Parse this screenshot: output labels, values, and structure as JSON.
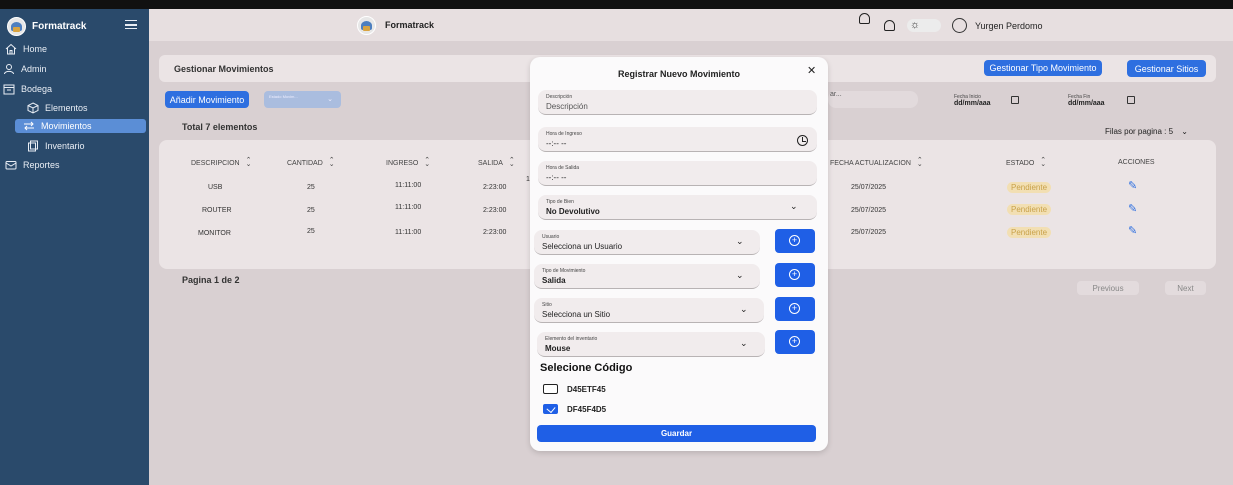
{
  "app": {
    "name": "Formatrack"
  },
  "sidebar": {
    "items": [
      {
        "label": "Home"
      },
      {
        "label": "Admin"
      },
      {
        "label": "Bodega"
      },
      {
        "label": "Elementos"
      },
      {
        "label": "Movimientos"
      },
      {
        "label": "Inventario"
      },
      {
        "label": "Reportes"
      }
    ]
  },
  "header": {
    "title": "Formatrack",
    "user": "Yurgen Perdomo"
  },
  "main": {
    "title": "Gestionar Movimientos",
    "btn_tipo": "Gestionar Tipo Movimiento",
    "btn_sitios": "Gestionar Sitios",
    "btn_add": "Añadir Movimiento",
    "filter_label": "Estado\nMovim...",
    "total": "Total 7 elementos",
    "search_frag": "ar...",
    "fecha_inicio_label": "Fecha Inicio",
    "fecha_fin_label": "Fecha Fin",
    "date_ph": "dd/mm/aaa",
    "filas": "Filas por pagina : 5",
    "pagina": "Pagina 1 de 2",
    "previous": "Previous",
    "next": "Next"
  },
  "table": {
    "headers": {
      "descripcion": "DESCRIPCION",
      "cantidad": "CANTIDAD",
      "ingreso": "INGRESO",
      "salida": "SALIDA",
      "fecha_act": "FECHA ACTUALIZACION",
      "estado": "ESTADO",
      "acciones": "ACCIONES"
    },
    "rows": [
      {
        "descripcion": "USB",
        "cantidad": "25",
        "ingreso": "11:11:00",
        "salida": "2:23:00",
        "fecha": "25/07/2025",
        "estado": "Pendiente"
      },
      {
        "descripcion": "ROUTER",
        "cantidad": "25",
        "ingreso": "11:11:00",
        "salida": "2:23:00",
        "fecha": "25/07/2025",
        "estado": "Pendiente"
      },
      {
        "descripcion": "MONITOR",
        "cantidad": "25",
        "ingreso": "11:11:00",
        "salida": "2:23:00",
        "fecha": "25/07/2025",
        "estado": "Pendiente"
      }
    ],
    "frag": "1"
  },
  "modal": {
    "title": "Registrar Nuevo Movimiento",
    "descripcion": {
      "label": "Descripción",
      "placeholder": "Descripción"
    },
    "hora_ingreso": {
      "label": "Hora de Ingreso",
      "value": "--:-- --"
    },
    "hora_salida": {
      "label": "Hora de Salida",
      "value": "--:-- --"
    },
    "tipo_bien": {
      "label": "Tipo de Bien",
      "value": "No Devolutivo"
    },
    "usuario": {
      "label": "Usuario",
      "value": "Selecciona un Usuario"
    },
    "tipo_mov": {
      "label": "Tipo de Movimiento",
      "value": "Salida"
    },
    "sitio": {
      "label": "Sitio",
      "value": "Selecciona un Sitio"
    },
    "elemento": {
      "label": "Elemento del inventario",
      "value": "Mouse"
    },
    "codes_title": "Selecione Código",
    "codes": [
      {
        "code": "D45ETF45",
        "checked": false
      },
      {
        "code": "DF45F4D5",
        "checked": true
      }
    ],
    "save": "Guardar"
  },
  "colors": {
    "sidebar": "#2a4a6b",
    "primary": "#1f5fe6",
    "badge": "#f2dfb3"
  }
}
